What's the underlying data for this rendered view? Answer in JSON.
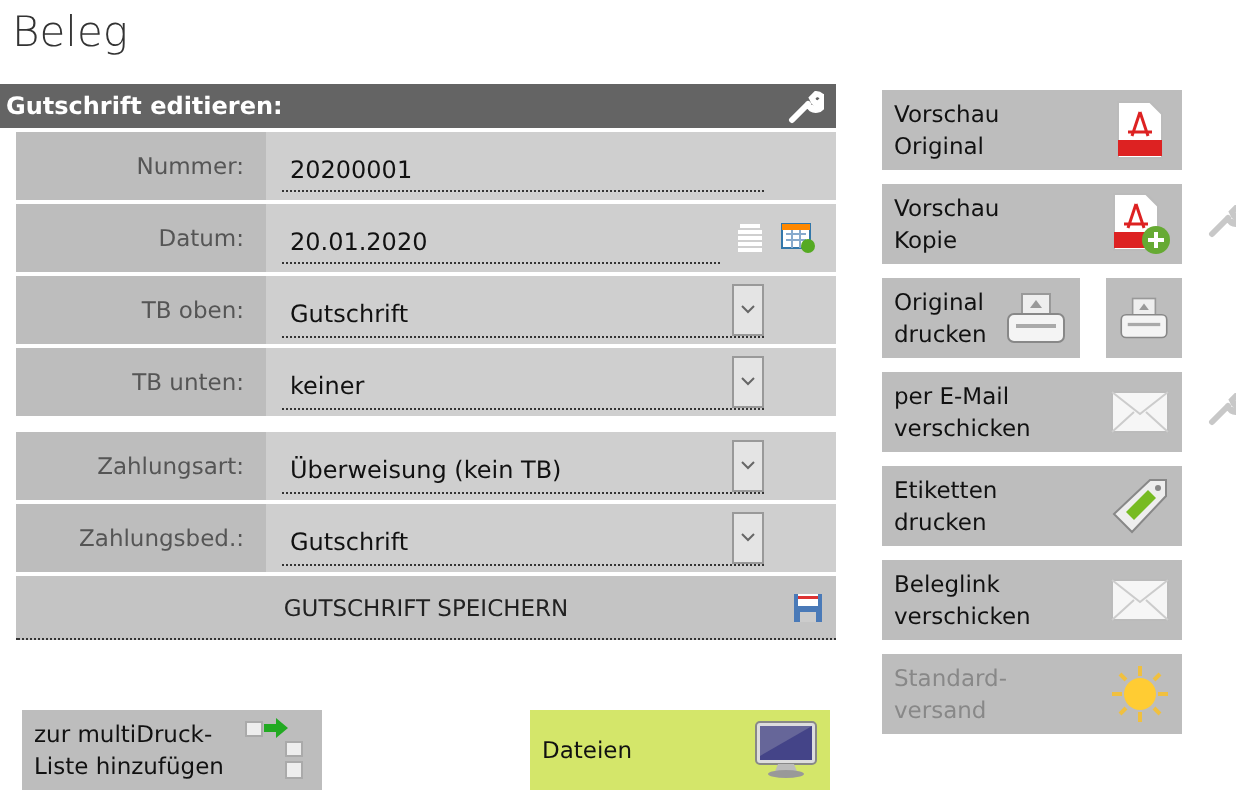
{
  "page_title": "Beleg",
  "form": {
    "title": "Gutschrift editieren:",
    "groups": [
      [
        {
          "kind": "text",
          "label": "Nummer:",
          "value": "20200001"
        },
        {
          "kind": "date",
          "label": "Datum:",
          "value": "20.01.2020"
        },
        {
          "kind": "select",
          "label": "TB oben:",
          "value": "Gutschrift"
        },
        {
          "kind": "select",
          "label": "TB unten:",
          "value": "keiner"
        }
      ],
      [
        {
          "kind": "select",
          "label": "Zahlungsart:",
          "value": "Überweisung (kein TB)"
        },
        {
          "kind": "select",
          "label": "Zahlungsbed.:",
          "value": "Gutschrift"
        }
      ]
    ],
    "save_button": "GUTSCHRIFT SPEICHERN"
  },
  "actions": [
    {
      "kind": "pdf",
      "label": [
        "Vorschau",
        "Original"
      ],
      "disabled": false,
      "settings": false
    },
    {
      "kind": "pdf-copy",
      "label": [
        "Vorschau",
        "Kopie"
      ],
      "disabled": false,
      "settings": true
    },
    {
      "kind": "print",
      "label": [
        "Original",
        "drucken"
      ],
      "disabled": false,
      "settings": false,
      "extra_button": true
    },
    {
      "kind": "mail",
      "label": [
        "per E-Mail",
        "verschicken"
      ],
      "disabled": false,
      "settings": true
    },
    {
      "kind": "tag",
      "label": [
        "Etiketten",
        "drucken"
      ],
      "disabled": false,
      "settings": false
    },
    {
      "kind": "mail",
      "label": [
        "Beleglink",
        "verschicken"
      ],
      "disabled": false,
      "settings": false
    },
    {
      "kind": "sun",
      "label": [
        "Standard-",
        "versand"
      ],
      "disabled": true,
      "settings": false
    }
  ],
  "bottom": [
    {
      "kind": "multi",
      "label": [
        "zur multiDruck-",
        "Liste hinzufügen"
      ],
      "highlight": false
    },
    {
      "kind": "monitor",
      "label": [
        "Dateien"
      ],
      "highlight": true
    }
  ]
}
